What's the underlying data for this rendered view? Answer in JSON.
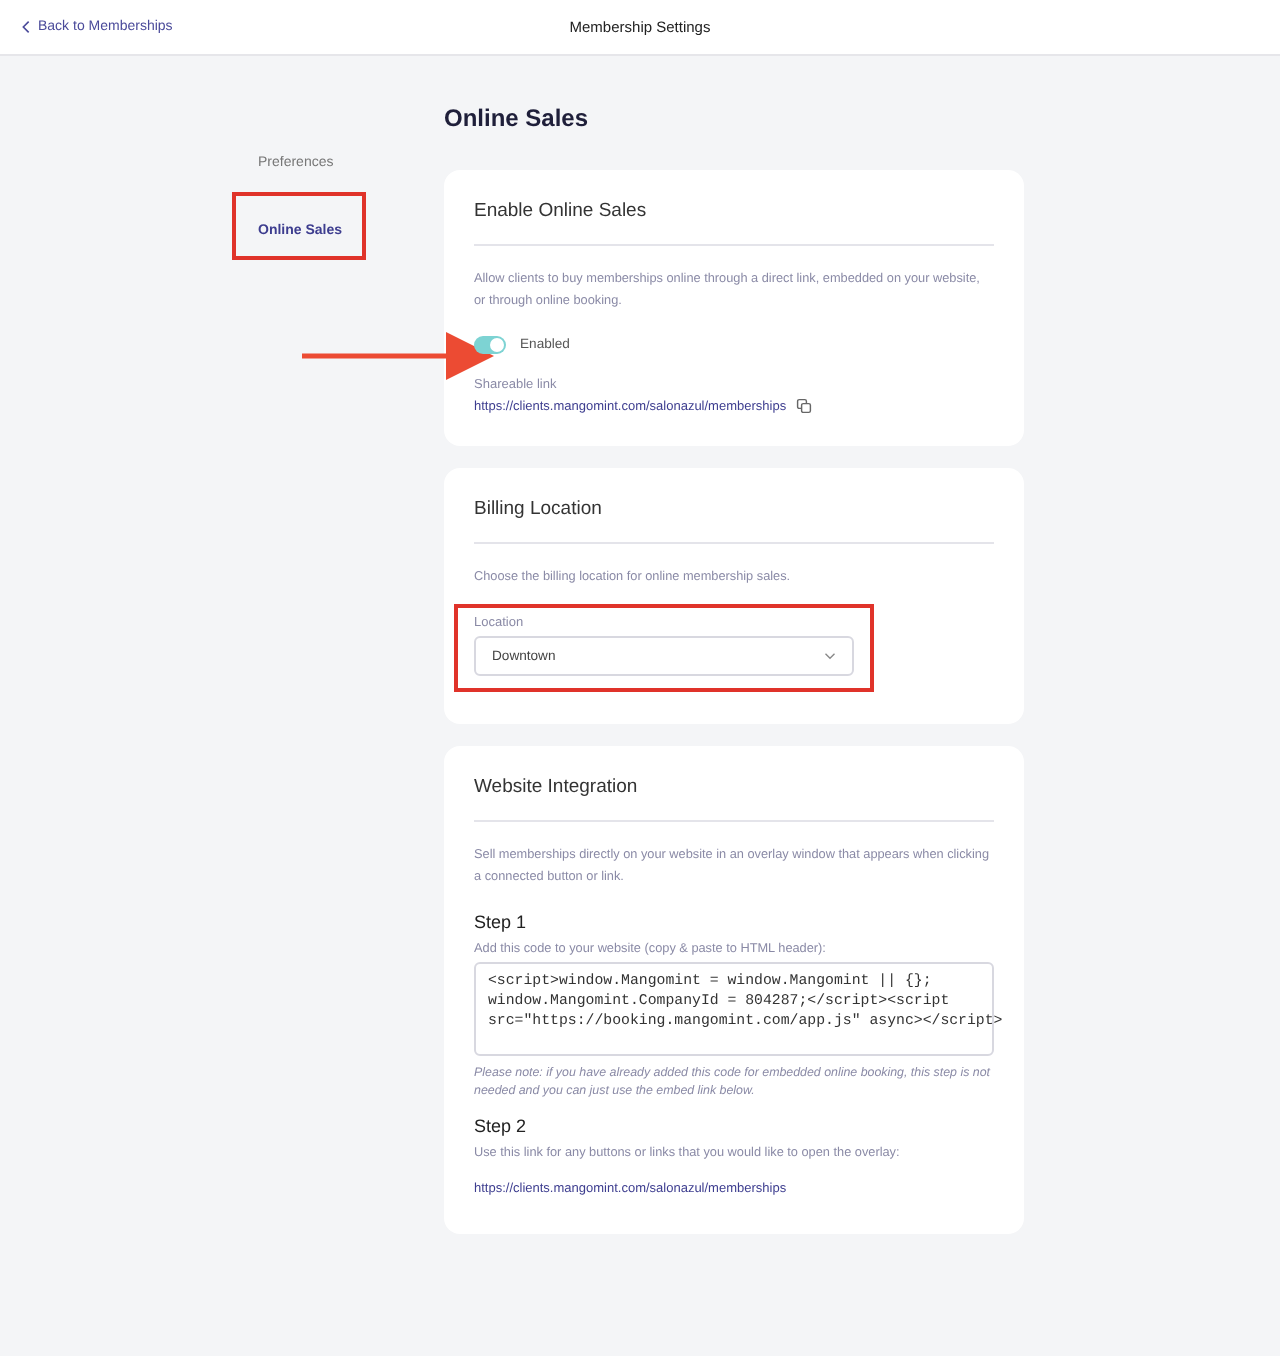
{
  "header": {
    "back_link": "Back to Memberships",
    "title": "Membership Settings"
  },
  "sidebar": {
    "items": [
      {
        "label": "Preferences",
        "selected": false,
        "highlighted": false
      },
      {
        "label": "Online Sales",
        "selected": true,
        "highlighted": true
      }
    ]
  },
  "page_title": "Online Sales",
  "enable_card": {
    "title": "Enable Online Sales",
    "description": "Allow clients to buy memberships online through a direct link, embedded on your website, or through online booking.",
    "toggle": {
      "label": "Enabled",
      "on": true,
      "pointed": true
    },
    "link_label": "Shareable link",
    "link": "https://clients.mangomint.com/salonazul/memberships"
  },
  "billing_card": {
    "title": "Billing Location",
    "description": "Choose the billing location for online membership sales.",
    "field": {
      "label": "Location",
      "value": "Downtown",
      "highlighted": true
    }
  },
  "integration_card": {
    "title": "Website Integration",
    "description": "Sell memberships directly on your website in an overlay window that appears when clicking a connected button or link.",
    "step1": {
      "title": "Step 1",
      "instruction": "Add this code to your website (copy & paste to HTML header):",
      "code": "<script>window.Mangomint = window.Mangomint || {};\nwindow.Mangomint.CompanyId = 804287;</script><script\nsrc=\"https://booking.mangomint.com/app.js\" async></script>",
      "note": "Please note: if you have already added this code for embedded online booking, this step is not needed and you can just use the embed link below."
    },
    "step2": {
      "title": "Step 2",
      "instruction": "Use this link for any buttons or links that you would like to open the overlay:",
      "link": "https://clients.mangomint.com/salonazul/memberships"
    }
  }
}
